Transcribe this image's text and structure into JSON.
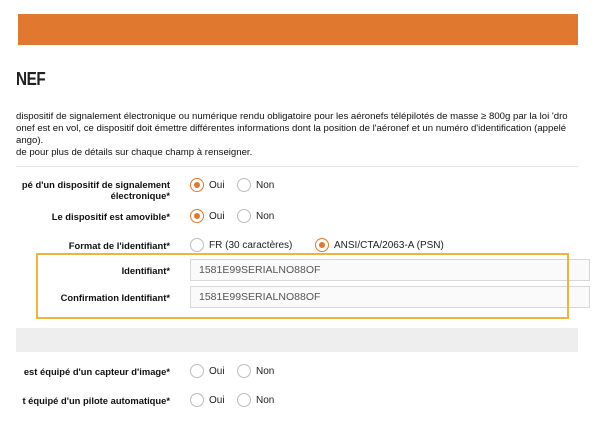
{
  "page": {
    "title": "NEF"
  },
  "intro": {
    "lines": [
      "dispositif de signalement électronique ou numérique rendu obligatoire pour les aéronefs télépilotés de masse ≥ 800g par la loi 'dro",
      "onef est en vol, ce dispositif doit émettre différentes informations dont la position de l'aéronef et un numéro d'identification (appelé",
      "ango).",
      "de pour plus de détails sur chaque champ à renseigner."
    ]
  },
  "form": {
    "equipped_signal": {
      "label_line1": "pé d'un dispositif de signalement",
      "label_line2": "électronique*",
      "options": [
        "Oui",
        "Non"
      ],
      "selected": "Oui"
    },
    "removable": {
      "label": "Le dispositif est amovible*",
      "options": [
        "Oui",
        "Non"
      ],
      "selected": "Oui"
    },
    "id_format": {
      "label": "Format de l'identifiant*",
      "options": [
        "FR (30 caractères)",
        "ANSI/CTA/2063-A (PSN)"
      ],
      "selected": "ANSI/CTA/2063-A (PSN)"
    },
    "identifier": {
      "label": "Identifiant*",
      "value": "1581E99SERIALNO88OF"
    },
    "identifier_confirm": {
      "label": "Confirmation Identifiant*",
      "value": "1581E99SERIALNO88OF"
    },
    "image_sensor": {
      "label": "est équipé d'un capteur d'image*",
      "options": [
        "Oui",
        "Non"
      ],
      "selected": null
    },
    "autopilot": {
      "label": "t équipé d'un pilote automatique*",
      "options": [
        "Oui",
        "Non"
      ],
      "selected": null
    }
  },
  "colors": {
    "accent": "#e0782f",
    "highlight": "#f0b43c"
  }
}
